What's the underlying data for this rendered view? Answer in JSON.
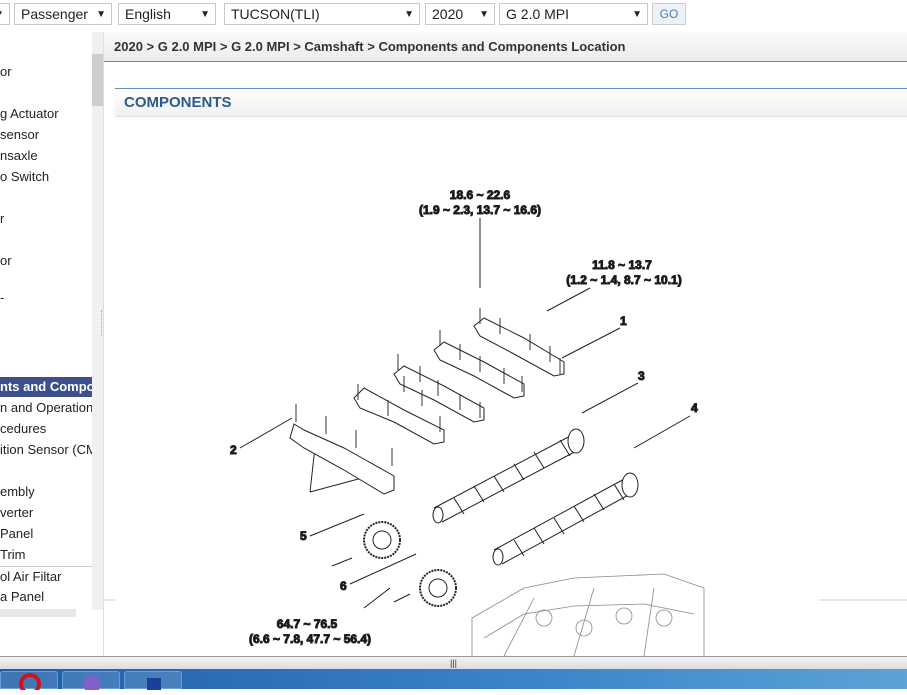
{
  "toolbar": {
    "selects": [
      "Passenger",
      "English",
      "TUCSON(TLI)",
      "2020",
      "G 2.0 MPI"
    ],
    "go_label": "GO"
  },
  "sidebar": {
    "items": [
      "or",
      "g Actuator",
      " sensor",
      "nsaxle",
      "o Switch",
      "r",
      "or",
      "-",
      "nts and Compo",
      "n and Operation",
      "cedures",
      "ition Sensor (CM",
      "embly",
      "verter",
      " Panel",
      "Trim",
      "ol Air Filtar",
      "a Panel"
    ],
    "active_index": 8
  },
  "breadcrumb": "2020 > G 2.0 MPI > G 2.0 MPI > Camshaft > Components and Components Location",
  "section_title": "COMPONENTS",
  "diagram": {
    "torque_top": [
      "18.6 ~ 22.6",
      "(1.9 ~ 2.3, 13.7 ~ 16.6)"
    ],
    "torque_right": [
      "11.8 ~ 13.7",
      "(1.2 ~ 1.4, 8.7 ~ 10.1)"
    ],
    "torque_bottom": [
      "64.7 ~ 76.5",
      "(6.6 ~ 7.8, 47.7 ~ 56.4)"
    ],
    "callouts": [
      "1",
      "2",
      "3",
      "4",
      "5",
      "6"
    ]
  },
  "splitter_glyph": "|||",
  "taskbar": {
    "apps": [
      "opera-icon",
      "viber-icon",
      "app-icon"
    ]
  },
  "colors": {
    "accent": "#2a5b8a",
    "active_item": "#3d4f8c",
    "taskbar": "#2a6fb8"
  }
}
